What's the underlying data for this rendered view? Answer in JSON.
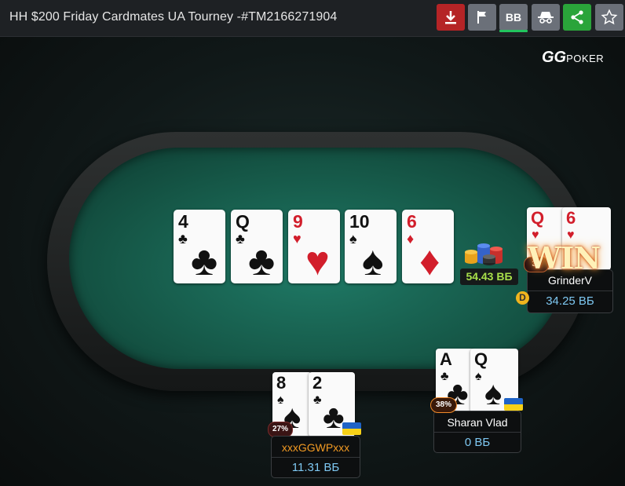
{
  "header": {
    "title": "HH $200 Friday Cardmates UA Tourney -#TM2166271904",
    "buttons": {
      "download": "download-icon",
      "report": "flag-icon",
      "bb_label": "BB",
      "incognito": "incognito-icon",
      "share": "share-icon",
      "favorite": "star-icon"
    }
  },
  "colors": {
    "download": "#b52426",
    "report": "#6b7079",
    "bb": "#6b7079",
    "incognito": "#6b7079",
    "share": "#2aa43a",
    "favorite": "#6b7079",
    "felt": "#1a6a57",
    "stack": "#7ec8f2",
    "pot": "#a8e04a",
    "hero_name": "#f29a23"
  },
  "logo": {
    "mark": "GG",
    "text": "POKER"
  },
  "board": [
    {
      "rank": "4",
      "suit": "♣",
      "color": "blk"
    },
    {
      "rank": "Q",
      "suit": "♣",
      "color": "blk"
    },
    {
      "rank": "9",
      "suit": "♥",
      "color": "red"
    },
    {
      "rank": "10",
      "suit": "♠",
      "color": "blk"
    },
    {
      "rank": "6",
      "suit": "♦",
      "color": "red"
    }
  ],
  "pot": {
    "amount": "54.43 ВБ"
  },
  "players": {
    "grinderv": {
      "name": "GrinderV",
      "stack": "34.25 ВБ",
      "equity": "38",
      "result": "WIN",
      "dealer": "D",
      "cards": [
        {
          "rank": "Q",
          "suit": "♥",
          "color": "red"
        },
        {
          "rank": "6",
          "suit": "♥",
          "color": "red"
        }
      ]
    },
    "sharan": {
      "name": "Sharan Vlad",
      "stack": "0 ВБ",
      "equity": "38%",
      "cards": [
        {
          "rank": "A",
          "suit": "♣",
          "color": "blk"
        },
        {
          "rank": "Q",
          "suit": "♠",
          "color": "blk"
        }
      ]
    },
    "hero": {
      "name": "xxxGGWPxxx",
      "stack": "11.31 ВБ",
      "equity": "27%",
      "cards": [
        {
          "rank": "8",
          "suit": "♠",
          "color": "blk"
        },
        {
          "rank": "2",
          "suit": "♣",
          "color": "blk"
        }
      ]
    }
  }
}
